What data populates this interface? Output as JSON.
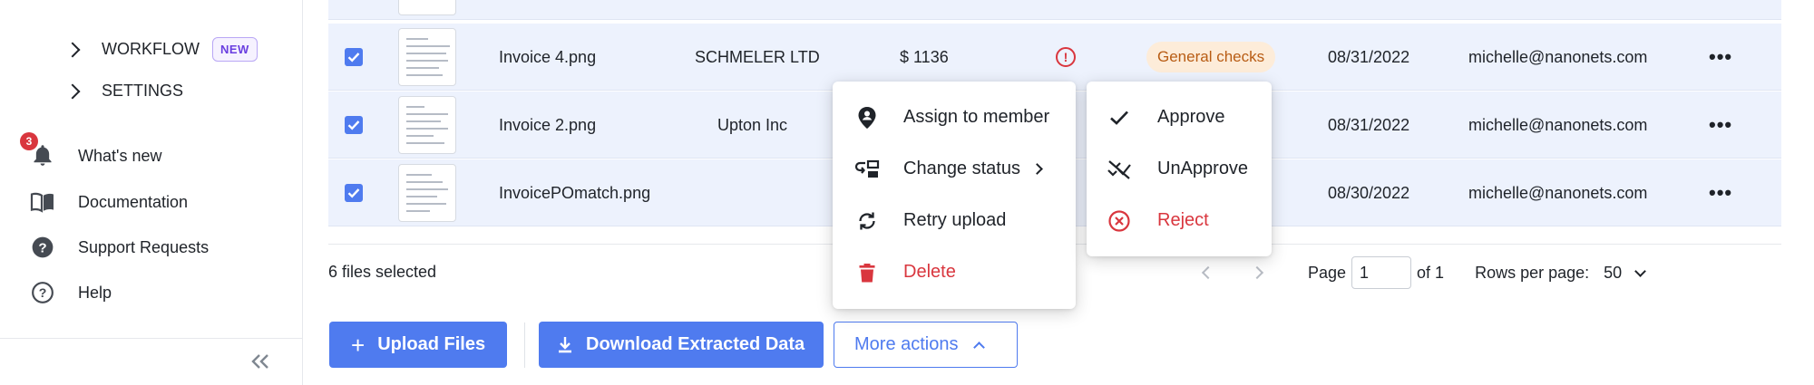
{
  "sidebar": {
    "workflow": {
      "label": "WORKFLOW",
      "badge": "NEW"
    },
    "settings": {
      "label": "SETTINGS"
    },
    "whats_new": {
      "label": "What's new",
      "count": "3"
    },
    "documentation": {
      "label": "Documentation"
    },
    "support": {
      "label": "Support Requests"
    },
    "help": {
      "label": "Help"
    }
  },
  "table": {
    "rows": [
      {
        "file": "Invoice 4.png",
        "vendor": "SCHMELER LTD",
        "amount": "$ 1136",
        "status": "General checks",
        "date": "08/31/2022",
        "email": "michelle@nanonets.com"
      },
      {
        "file": "Invoice 2.png",
        "vendor": "Upton Inc",
        "amount": "",
        "status": "",
        "date": "08/31/2022",
        "email": "michelle@nanonets.com"
      },
      {
        "file": "InvoicePOmatch.png",
        "vendor": "",
        "amount": "",
        "status": "",
        "date": "08/30/2022",
        "email": "michelle@nanonets.com"
      }
    ]
  },
  "footer": {
    "selected": "6 files selected",
    "page_label": "Page",
    "page_value": "1",
    "of_label": "of 1",
    "rows_label": "Rows per page:",
    "rows_value": "50"
  },
  "actions": {
    "upload": "Upload Files",
    "download": "Download Extracted Data",
    "more": "More actions"
  },
  "more_menu": {
    "assign": "Assign to member",
    "change_status": "Change status",
    "retry": "Retry upload",
    "delete": "Delete"
  },
  "status_menu": {
    "approve": "Approve",
    "unapprove": "UnApprove",
    "reject": "Reject"
  },
  "colors": {
    "accent": "#4f7bef",
    "danger": "#d9363e",
    "row_selected": "#edf2fd",
    "pill_bg": "#fdecd9",
    "pill_text": "#b85c14",
    "new_badge": "#6a3fe0"
  }
}
